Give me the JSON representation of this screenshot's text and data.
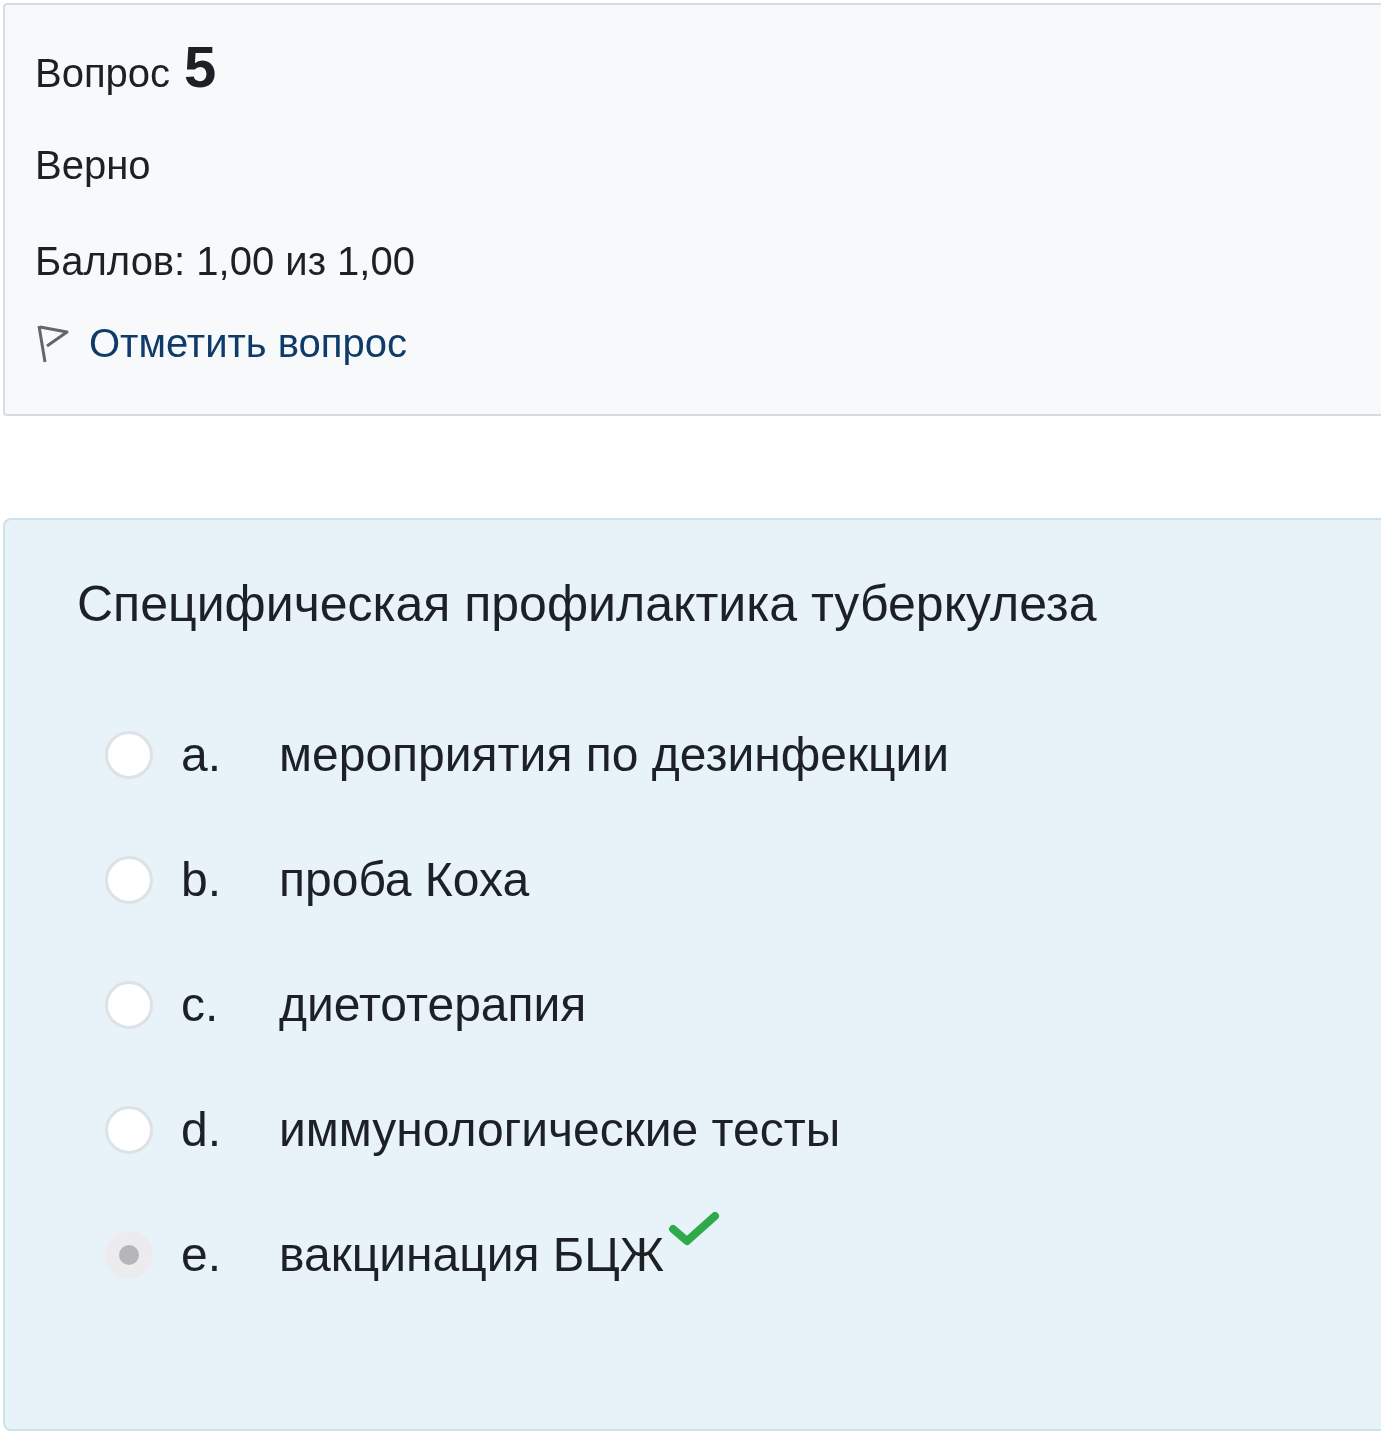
{
  "info": {
    "label": "Вопрос",
    "number": "5",
    "status": "Верно",
    "grade": "Баллов: 1,00 из 1,00",
    "flag_link": "Отметить вопрос"
  },
  "question": {
    "text": "Специфическая профилактика туберкулеза",
    "options": [
      {
        "letter": "a.",
        "text": "мероприятия по дезинфекции",
        "selected": false,
        "correct": false
      },
      {
        "letter": "b.",
        "text": "проба Коха",
        "selected": false,
        "correct": false
      },
      {
        "letter": "c.",
        "text": "диетотерапия",
        "selected": false,
        "correct": false
      },
      {
        "letter": "d.",
        "text": "иммунологические тесты",
        "selected": false,
        "correct": false
      },
      {
        "letter": "e.",
        "text": "вакцинация БЦЖ",
        "selected": true,
        "correct": true
      }
    ]
  }
}
